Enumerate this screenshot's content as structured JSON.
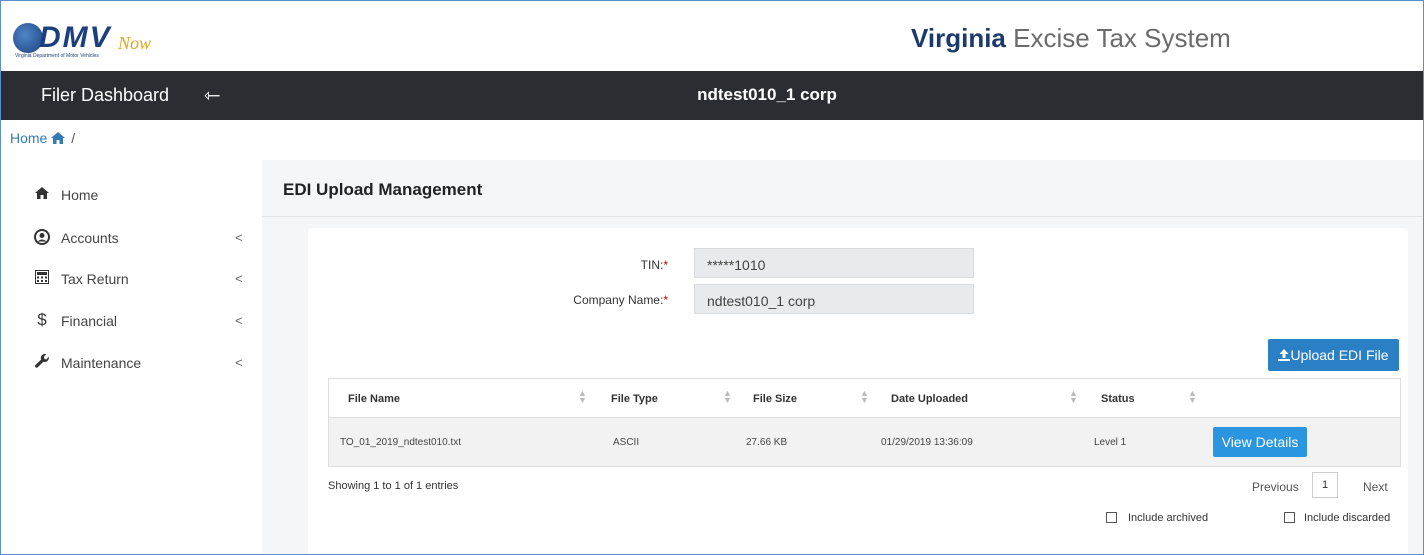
{
  "header": {
    "logo": {
      "brand": "DMV",
      "now": "Now",
      "sub": "Virginia Department of Motor Vehicles"
    },
    "system_title_bold": "Virginia",
    "system_title_rest": "Excise Tax System"
  },
  "topbar": {
    "dashboard_title": "Filer Dashboard",
    "collapse_icon": "arrow-left-icon",
    "company_name": "ndtest010_1 corp"
  },
  "breadcrumb": {
    "home": "Home",
    "separator": "/"
  },
  "sidebar": {
    "items": [
      {
        "label": "Home",
        "icon": "home-icon",
        "has_children": false
      },
      {
        "label": "Accounts",
        "icon": "user-circle-icon",
        "has_children": true
      },
      {
        "label": "Tax Return",
        "icon": "calculator-icon",
        "has_children": true
      },
      {
        "label": "Financial",
        "icon": "dollar-icon",
        "has_children": true
      },
      {
        "label": "Maintenance",
        "icon": "wrench-icon",
        "has_children": true
      }
    ],
    "chevron": "<"
  },
  "main": {
    "title": "EDI Upload Management",
    "form": {
      "tin_label": "TIN:",
      "tin_value": "*****1010",
      "company_label": "Company Name:",
      "company_value": "ndtest010_1 corp",
      "required_mark": "*"
    },
    "upload_button": "Upload EDI File",
    "table": {
      "columns": [
        "File Name",
        "File Type",
        "File Size",
        "Date Uploaded",
        "Status"
      ],
      "rows": [
        {
          "file_name": "TO_01_2019_ndtest010.txt",
          "file_type": "ASCII",
          "file_size": "27.66 KB",
          "date_uploaded": "01/29/2019 13:36:09",
          "status": "Level 1",
          "action": "View Details"
        }
      ]
    },
    "showing": "Showing 1 to 1 of 1 entries",
    "pager": {
      "previous": "Previous",
      "current": "1",
      "next": "Next"
    },
    "filters": {
      "archived": "Include archived",
      "discarded": "Include discarded"
    }
  },
  "colors": {
    "dark_bar": "#2a2e33",
    "primary_button": "#2b7fc4",
    "view_button": "#2b95e0",
    "link": "#337ab7",
    "required": "#cc0000"
  }
}
